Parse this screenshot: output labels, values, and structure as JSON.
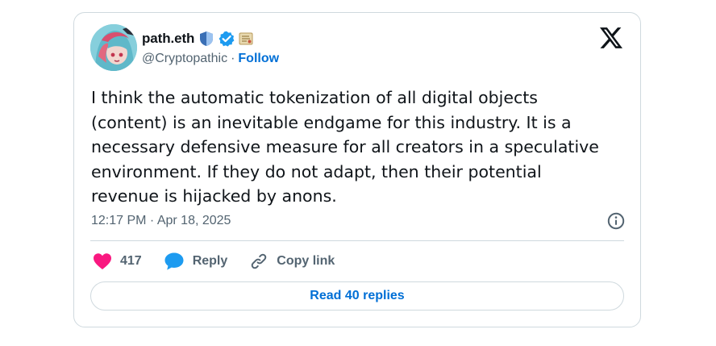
{
  "tweet": {
    "author": {
      "display_name": "path.eth",
      "handle": "@Cryptopathic",
      "separator": "·",
      "follow_label": "Follow",
      "badges": [
        "shield-badge-icon",
        "verified-badge-icon",
        "scroll-emoji-icon"
      ]
    },
    "text": "I think the automatic tokenization of all digital objects\n(content) is an inevitable endgame for this industry. It is a\nnecessary defensive measure for all creators in a speculative\nenvironment. If they do not adapt, then their potential\nrevenue is hijacked by anons.",
    "timestamp": "12:17 PM · Apr 18, 2025",
    "actions": {
      "like_count": "417",
      "reply_label": "Reply",
      "copy_link_label": "Copy link"
    },
    "read_replies_label": "Read 40 replies"
  },
  "colors": {
    "link_blue": "#006fd6",
    "verified_blue": "#1d9bf0",
    "like_pink": "#f91880",
    "text_primary": "#0f1419",
    "text_secondary": "#536471",
    "border": "#cfd9de"
  },
  "icons": {
    "platform": "x-logo-icon",
    "info": "info-icon",
    "like": "heart-icon",
    "reply": "speech-bubble-icon",
    "copy_link": "link-icon"
  }
}
